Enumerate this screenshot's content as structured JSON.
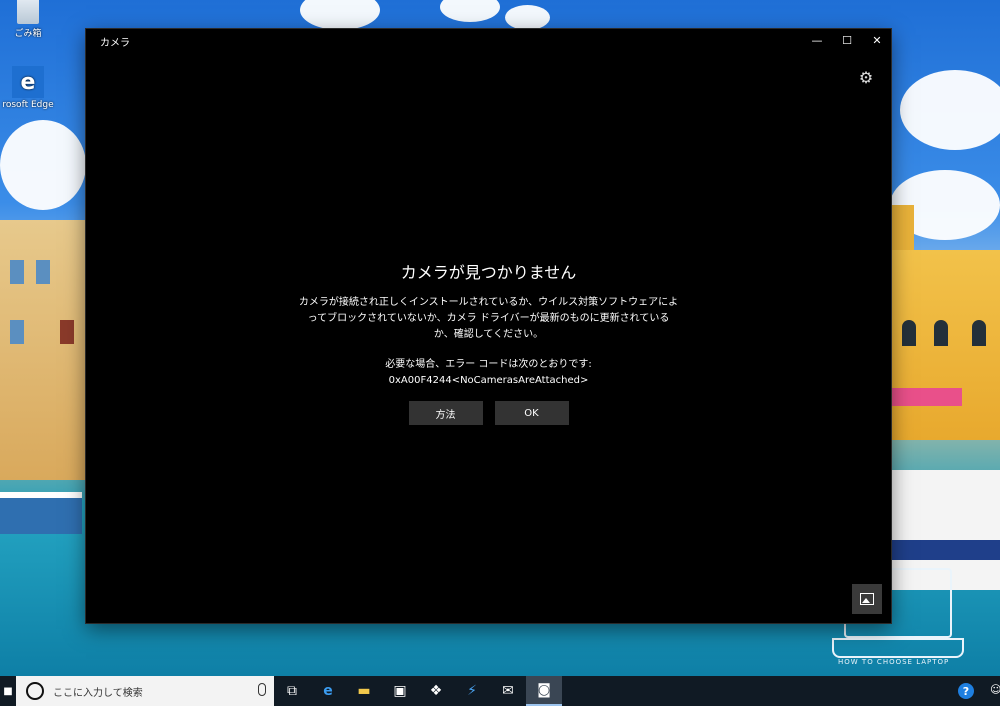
{
  "desktop": {
    "recycle_bin_label": "ごみ箱",
    "edge_label": "rosoft Edge",
    "wallpaper_caption": "HOW TO CHOOSE LAPTOP"
  },
  "window": {
    "title": "カメラ",
    "minimize_glyph": "—",
    "maximize_glyph": "☐",
    "close_glyph": "✕",
    "settings_icon": "⚙"
  },
  "error": {
    "heading": "カメラが見つかりません",
    "message": "カメラが接続され正しくインストールされているか、ウイルス対策ソフトウェアによってブロックされていないか、カメラ ドライバーが最新のものに更新されているか、確認してください。",
    "code_intro": "必要な場合、エラー コードは次のとおりです:",
    "code": "0xA00F4244<NoCamerasAreAttached>",
    "howto_button": "方法",
    "ok_button": "OK"
  },
  "taskbar": {
    "search_placeholder": "ここに入力して検索",
    "help": "?",
    "icons": {
      "task_view": "⧉",
      "edge": "e",
      "explorer": "▬",
      "store": "▣",
      "dropbox": "❖",
      "app": "⚡",
      "mail": "✉",
      "camera": "◙"
    }
  }
}
